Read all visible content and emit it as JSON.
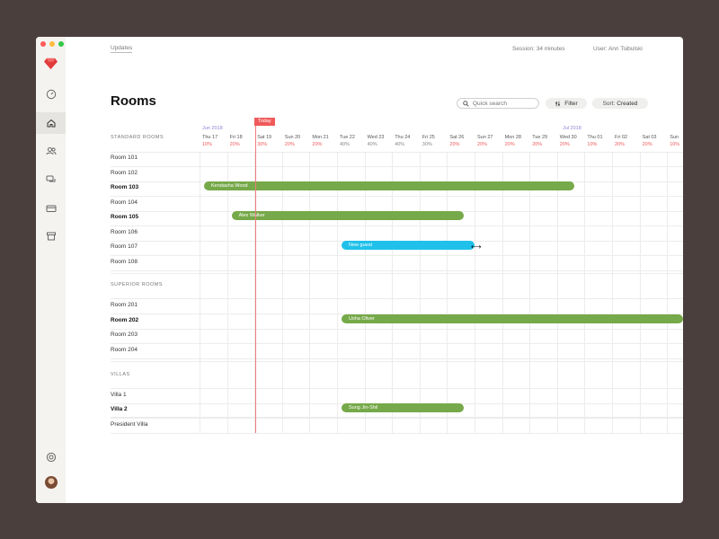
{
  "colors": {
    "accent_red": "#f05a5a",
    "booking_green": "#76a949",
    "booking_blue": "#1fc1ea",
    "month_purple": "#8f84d8"
  },
  "topbar": {
    "updates": "Updates",
    "session": "Session: 34 minutes",
    "user": "User: Ann Tsibulski"
  },
  "page": {
    "title": "Rooms"
  },
  "search": {
    "placeholder": "Quick search",
    "icon": "search-icon"
  },
  "filter": {
    "label": "Filter",
    "icon": "filter-icon"
  },
  "sort": {
    "label": "Sort:",
    "value": "Created"
  },
  "sidebar": {
    "icons": [
      "ruby-logo-icon",
      "dashboard-gauge-icon",
      "home-icon",
      "guests-icon",
      "chat-icon",
      "payment-card-icon",
      "store-icon",
      "lifebuoy-icon",
      "avatar"
    ]
  },
  "calendar": {
    "months": [
      "Jun 2018",
      "Jul 2018"
    ],
    "today": "Today",
    "days": [
      {
        "label": "Thu 17",
        "pct": "10%",
        "pct_color": "#f05a5a"
      },
      {
        "label": "Fri 18",
        "pct": "20%",
        "pct_color": "#f05a5a"
      },
      {
        "label": "Sat 19",
        "pct": "30%",
        "pct_color": "#f05a5a"
      },
      {
        "label": "Sun 20",
        "pct": "20%",
        "pct_color": "#f05a5a"
      },
      {
        "label": "Mon 21",
        "pct": "20%",
        "pct_color": "#f05a5a"
      },
      {
        "label": "Tue 22",
        "pct": "40%",
        "pct_color": "#888888"
      },
      {
        "label": "Wed 23",
        "pct": "40%",
        "pct_color": "#888888"
      },
      {
        "label": "Thu 24",
        "pct": "40%",
        "pct_color": "#888888"
      },
      {
        "label": "Fri 25",
        "pct": "30%",
        "pct_color": "#888888"
      },
      {
        "label": "Sat 26",
        "pct": "20%",
        "pct_color": "#f05a5a"
      },
      {
        "label": "Sun 27",
        "pct": "20%",
        "pct_color": "#f05a5a"
      },
      {
        "label": "Mon 28",
        "pct": "20%",
        "pct_color": "#f05a5a"
      },
      {
        "label": "Tue 29",
        "pct": "20%",
        "pct_color": "#f05a5a"
      },
      {
        "label": "Wed 30",
        "pct": "20%",
        "pct_color": "#f05a5a"
      },
      {
        "label": "Thu 01",
        "pct": "10%",
        "pct_color": "#f05a5a"
      },
      {
        "label": "Fri 02",
        "pct": "20%",
        "pct_color": "#f05a5a"
      },
      {
        "label": "Sat 03",
        "pct": "20%",
        "pct_color": "#f05a5a"
      },
      {
        "label": "Sun",
        "pct": "10%",
        "pct_color": "#f05a5a"
      }
    ]
  },
  "sections": [
    {
      "title": "STANDARD ROOMS",
      "rooms": [
        {
          "name": "Room 101",
          "bold": false
        },
        {
          "name": "Room 102",
          "bold": false
        },
        {
          "name": "Room 103",
          "bold": true
        },
        {
          "name": "Room 104",
          "bold": false
        },
        {
          "name": "Room 105",
          "bold": true
        },
        {
          "name": "Room 106",
          "bold": false
        },
        {
          "name": "Room 107",
          "bold": false
        },
        {
          "name": "Room 108",
          "bold": false
        }
      ]
    },
    {
      "title": "SUPERIOR ROOMS",
      "rooms": [
        {
          "name": "Room 201",
          "bold": false
        },
        {
          "name": "Room 202",
          "bold": true
        },
        {
          "name": "Room 203",
          "bold": false
        },
        {
          "name": "Room 204",
          "bold": false
        }
      ]
    },
    {
      "title": "VILLAS",
      "rooms": [
        {
          "name": "Villa 1",
          "bold": false
        },
        {
          "name": "Villa 2",
          "bold": true
        },
        {
          "name": "President Villa",
          "bold": false
        }
      ]
    }
  ],
  "bookings": [
    {
      "guest": "Kendasha Wood",
      "room": "Room 103",
      "from": "Thu 17",
      "to": "Wed 30",
      "status": "confirmed"
    },
    {
      "guest": "Alex Walker",
      "room": "Room 105",
      "from": "Fri 18",
      "to": "Sat 26",
      "status": "confirmed"
    },
    {
      "guest": "New guest",
      "room": "Room 107",
      "from": "Tue 22",
      "to": "Sun 27",
      "status": "new"
    },
    {
      "guest": "Usha Oliver",
      "room": "Room 202",
      "from": "Tue 22",
      "to": "Sun",
      "status": "confirmed"
    },
    {
      "guest": "Sung Jin-Shil",
      "room": "Villa 2",
      "from": "Tue 22",
      "to": "Sat 26",
      "status": "confirmed"
    }
  ]
}
